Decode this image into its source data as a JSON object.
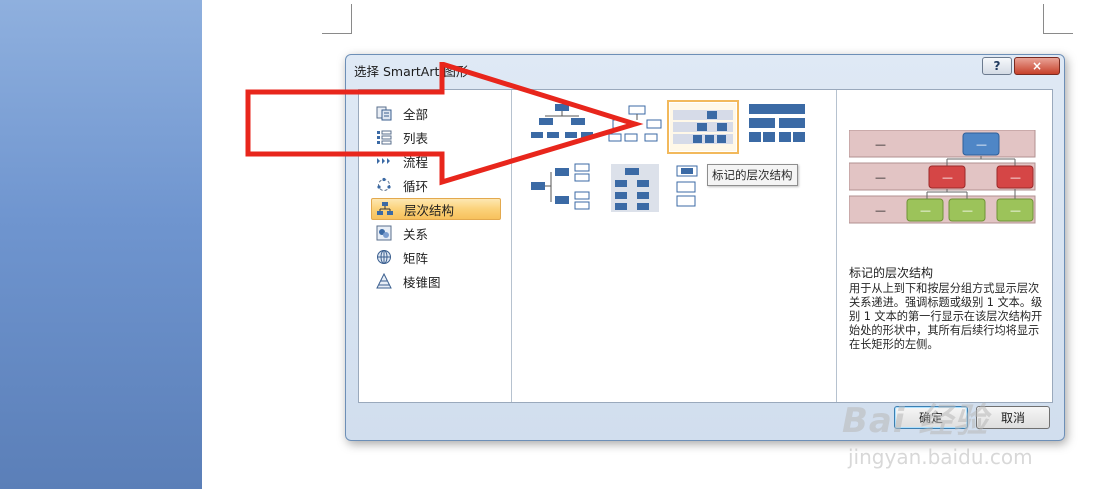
{
  "dialog": {
    "title": "选择 SmartArt 图形",
    "help_label": "?",
    "close_label": "×",
    "ok_label": "确定",
    "cancel_label": "取消"
  },
  "categories": [
    {
      "label": "全部",
      "icon": "all-icon"
    },
    {
      "label": "列表",
      "icon": "list-icon"
    },
    {
      "label": "流程",
      "icon": "process-icon"
    },
    {
      "label": "循环",
      "icon": "cycle-icon"
    },
    {
      "label": "层次结构",
      "icon": "hierarchy-icon",
      "selected": true
    },
    {
      "label": "关系",
      "icon": "relationship-icon"
    },
    {
      "label": "矩阵",
      "icon": "matrix-icon"
    },
    {
      "label": "棱锥图",
      "icon": "pyramid-icon"
    }
  ],
  "tooltip": "标记的层次结构",
  "preview": {
    "title": "标记的层次结构",
    "description": "用于从上到下和按层分组方式显示层次关系递进。强调标题或级别 1 文本。级别 1 文本的第一行显示在该层次结构开始处的形状中，其所有后续行均将显示在长矩形的左侧。",
    "placeholder": "—"
  },
  "watermark": {
    "brand": "Bai 经验",
    "sub": "jingyan.baidu.com"
  },
  "colors": {
    "accent_blue": "#3b6aa5",
    "annotation_red": "#e8261c",
    "selection_orange": "#f7c15c"
  }
}
